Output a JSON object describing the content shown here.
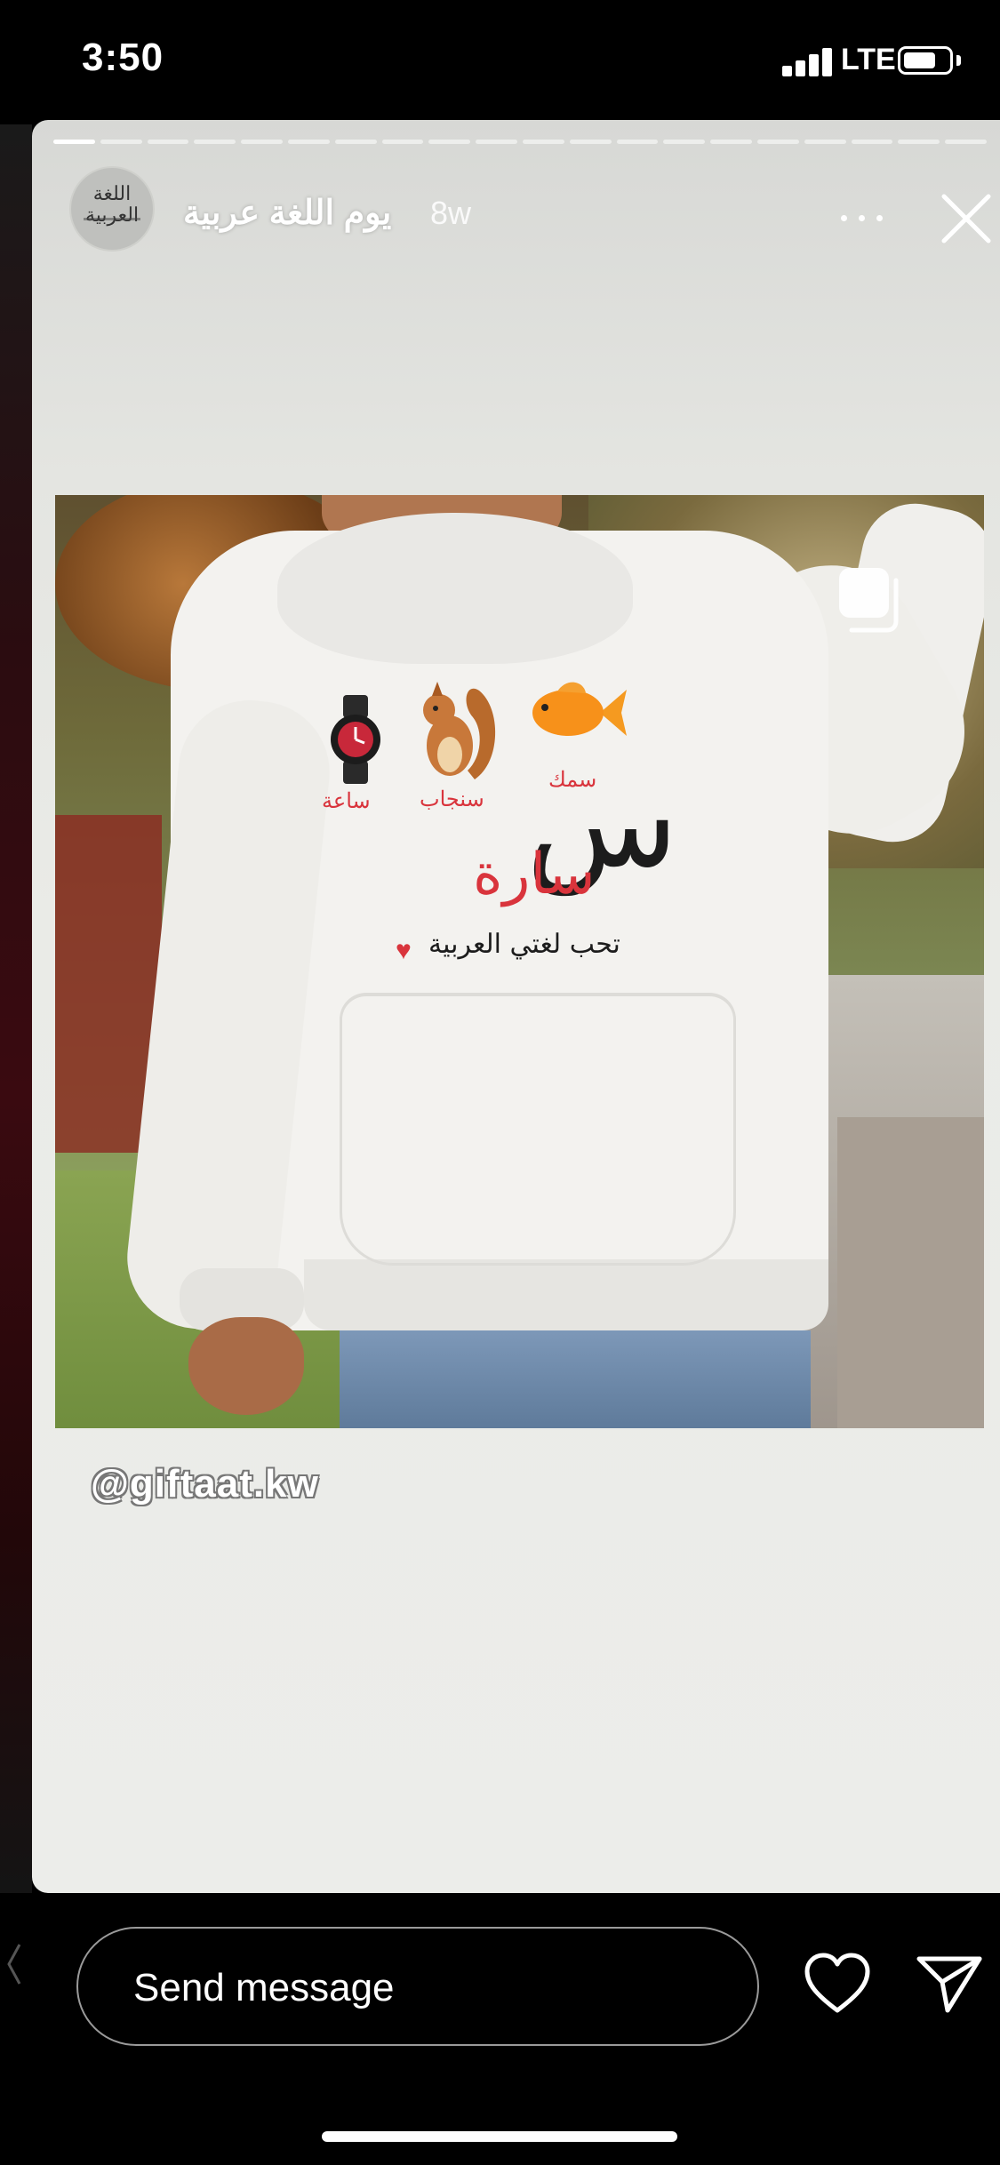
{
  "status_bar": {
    "time": "3:50",
    "network": "LTE",
    "icons": [
      "signal-icon",
      "battery-icon"
    ]
  },
  "story": {
    "account_name": "يوم اللغة عربية",
    "post_age": "8w",
    "avatar": {
      "name": "avatar-calligraphy",
      "calligraphy": "اللغة العربية"
    },
    "progress_segments_total": 20,
    "progress_segments_viewed": 1,
    "header_icons": [
      "more-options-icon",
      "close-icon"
    ],
    "image": {
      "description_icons": [
        "watch-icon",
        "squirrel-icon",
        "goldfish-icon",
        "multiple-photos-icon"
      ],
      "words": {
        "watch": "ساعة",
        "squirrel": "سنجاب",
        "fish": "سمك"
      },
      "big_letter": "س",
      "child_name": "سارة",
      "slogan": "تحب لغتي العربية",
      "slogan_icon": "heart-icon"
    },
    "watermark": "@giftaat.kw"
  },
  "bottom_bar": {
    "message_placeholder": "Send message",
    "icons": [
      "like-heart-icon",
      "send-paper-plane-icon"
    ]
  },
  "colors": {
    "background": "#000000",
    "card_background": "#ecedea",
    "print_red": "#d9343c",
    "text_white": "#ffffff"
  }
}
